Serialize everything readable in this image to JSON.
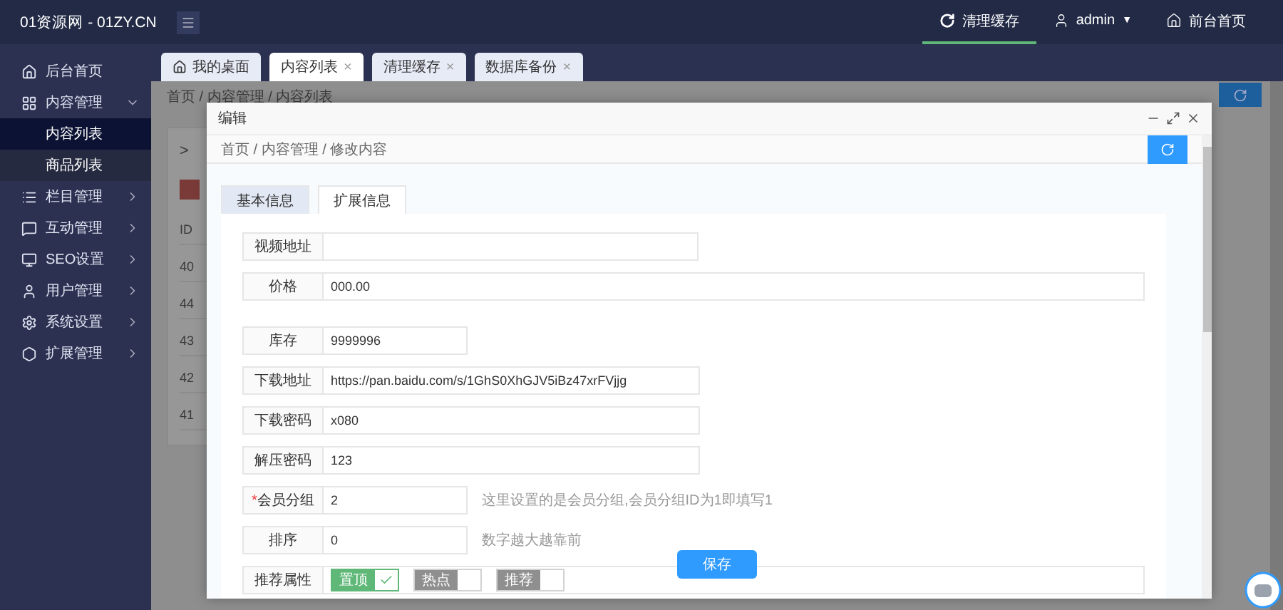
{
  "brand": "01资源网 - 01ZY.CN",
  "top_nav": [
    {
      "label": "清理缓存",
      "selected": true
    },
    {
      "label": "admin",
      "selected": false,
      "caret": "▼"
    },
    {
      "label": "前台首页",
      "selected": false
    }
  ],
  "sidebar": {
    "items": [
      {
        "label": "后台首页",
        "has_arrow": false
      },
      {
        "label": "内容管理",
        "expanded": true,
        "has_arrow": true,
        "children": [
          {
            "label": "内容列表",
            "selected": true
          },
          {
            "label": "商品列表",
            "selected": false
          }
        ]
      },
      {
        "label": "栏目管理",
        "expanded": false,
        "has_arrow": true
      },
      {
        "label": "互动管理",
        "expanded": false,
        "has_arrow": true
      },
      {
        "label": "SEO设置",
        "expanded": false,
        "has_arrow": true
      },
      {
        "label": "用户管理",
        "expanded": false,
        "has_arrow": true
      },
      {
        "label": "系统设置",
        "expanded": false,
        "has_arrow": true
      },
      {
        "label": "扩展管理",
        "expanded": false,
        "has_arrow": true
      }
    ]
  },
  "page_tabs": [
    {
      "label": "我的桌面",
      "selected": false,
      "closable": false
    },
    {
      "label": "内容列表",
      "selected": true,
      "closable": true
    },
    {
      "label": "清理缓存",
      "selected": false,
      "closable": true
    },
    {
      "label": "数据库备份",
      "selected": false,
      "closable": true
    }
  ],
  "close_glyph": "×",
  "background_page": {
    "breadcrumb": "首页 / 内容管理 / 内容列表",
    "toggle": ">",
    "id_header": "ID",
    "ids": [
      "40",
      "44",
      "43",
      "42",
      "41"
    ]
  },
  "dialog": {
    "title": "编辑",
    "breadcrumb": "首页 / 内容管理 / 修改内容",
    "tabs": [
      {
        "label": "基本信息",
        "selected": false
      },
      {
        "label": "扩展信息",
        "selected": true
      }
    ],
    "field_groups": [
      [
        {
          "kind": "text",
          "label": "视频地址"
        },
        {
          "kind": "text",
          "label": "价格",
          "value": "000.00"
        }
      ],
      [
        {
          "kind": "text",
          "label": "库存",
          "value": "9999996"
        },
        {
          "kind": "text",
          "label": "下载地址",
          "value": "https://pan.baidu.com/s/1GhS0XhGJV5iBz47xrFVjjg"
        },
        {
          "kind": "text",
          "label": "下载密码",
          "value": "x080"
        },
        {
          "kind": "text",
          "label": "解压密码",
          "value": "123"
        },
        {
          "kind": "text",
          "label": "会员分组",
          "required_mark": "*",
          "value": "2",
          "hint": "这里设置的是会员分组,会员分组ID为1即填写1"
        },
        {
          "kind": "text",
          "label": "排序",
          "value": "0",
          "hint": "数字越大越靠前"
        },
        {
          "kind": "switches",
          "label": "推荐属性",
          "options": [
            {
              "label": "置顶",
              "on": true
            },
            {
              "label": "热点",
              "on": false
            },
            {
              "label": "推荐",
              "on": false
            }
          ]
        }
      ]
    ],
    "save": "保存"
  }
}
